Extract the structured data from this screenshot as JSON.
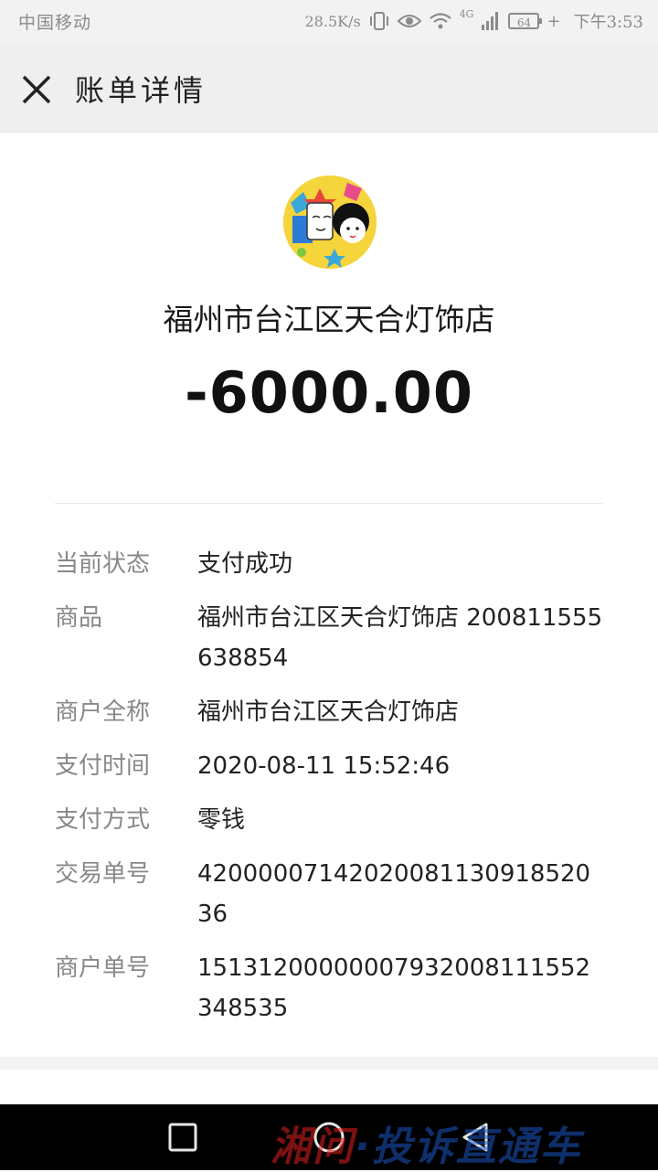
{
  "status_bar": {
    "carrier": "中国移动",
    "net_speed": "28.5K/s",
    "network": "4G",
    "battery": "64",
    "time": "下午3:53"
  },
  "header": {
    "title": "账单详情",
    "close_icon": "close-icon"
  },
  "bill": {
    "merchant_name": "福州市台江区天合灯饰店",
    "amount": "-6000.00"
  },
  "details": [
    {
      "label": "当前状态",
      "value": "支付成功"
    },
    {
      "label": "商品",
      "value": "福州市台江区天合灯饰店 200811555638854"
    },
    {
      "label": "商户全称",
      "value": "福州市台江区天合灯饰店"
    },
    {
      "label": "支付时间",
      "value": "2020-08-11 15:52:46"
    },
    {
      "label": "支付方式",
      "value": "零钱"
    },
    {
      "label": "交易单号",
      "value": "4200000714202008113091852036"
    },
    {
      "label": "商户单号",
      "value": "15131200000007932008111552348535"
    }
  ],
  "nav_bar": {
    "icons": [
      "recent-apps-icon",
      "home-icon",
      "back-icon"
    ]
  },
  "watermark": {
    "part1": "湘问",
    "part2": "·投诉直通车"
  }
}
